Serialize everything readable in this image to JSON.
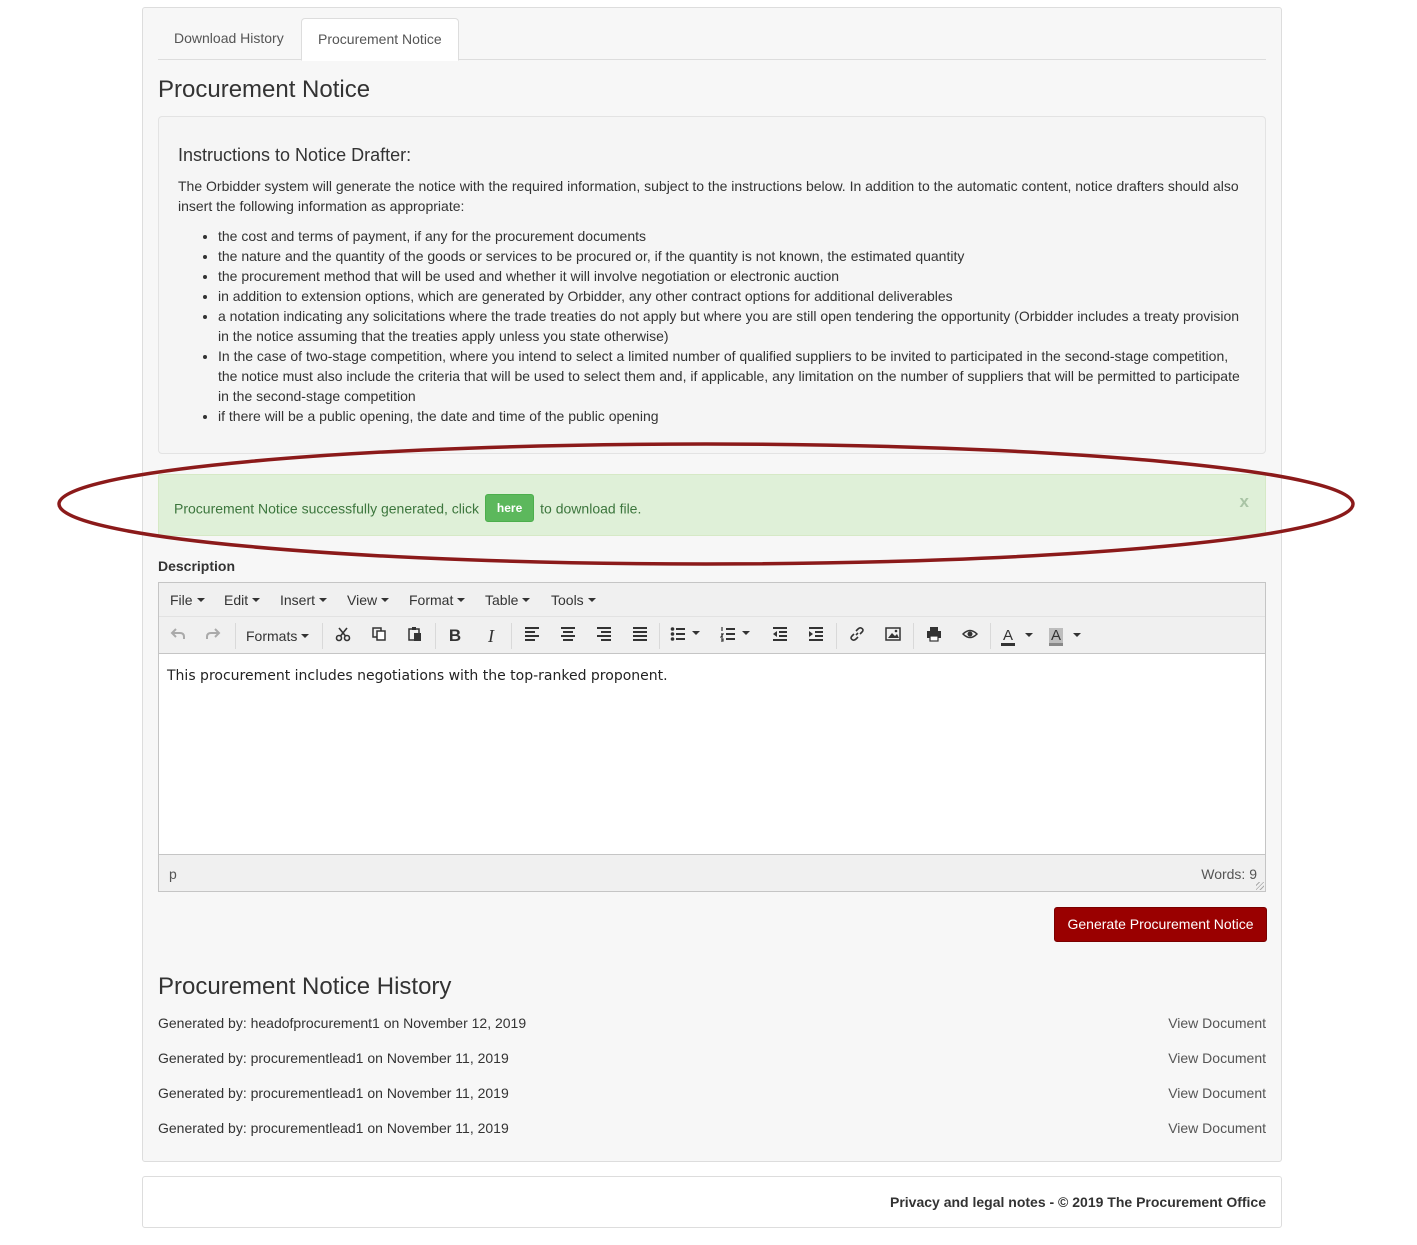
{
  "tabs": [
    {
      "label": "Download History"
    },
    {
      "label": "Procurement Notice"
    }
  ],
  "page_title": "Procurement Notice",
  "instructions": {
    "heading": "Instructions to Notice Drafter:",
    "intro": "The Orbidder system will generate the notice with the required information, subject to the instructions below. In addition to the automatic content, notice drafters should also insert the following information as appropriate:",
    "items": [
      "the cost and terms of payment, if any for the procurement documents",
      "the nature and the quantity of the goods or services to be procured or, if the quantity is not known, the estimated quantity",
      "the procurement method that will be used and whether it will involve negotiation or electronic auction",
      "in addition to extension options, which are generated by Orbidder, any other contract options for additional deliverables",
      "a notation indicating any solicitations where the trade treaties do not apply but where you are still open tendering the opportunity (Orbidder includes a treaty provision in the notice assuming that the treaties apply unless you state otherwise)",
      "In the case of two-stage competition, where you intend to select a limited number of qualified suppliers to be invited to participated in the second-stage competition, the notice must also include the criteria that will be used to select them and, if applicable, any limitation on the number of suppliers that will be permitted to participate in the second-stage competition",
      "if there will be a public opening, the date and time of the public opening"
    ]
  },
  "alert": {
    "text_before": "Procurement Notice successfully generated, click",
    "button_label": "here",
    "text_after": "to download file.",
    "close_label": "x"
  },
  "description_label": "Description",
  "editor": {
    "menu": [
      "File",
      "Edit",
      "Insert",
      "View",
      "Format",
      "Table",
      "Tools"
    ],
    "formats_label": "Formats",
    "toolbar_icons": [
      "undo-icon",
      "redo-icon",
      "cut-icon",
      "copy-icon",
      "paste-icon",
      "bold-icon",
      "italic-icon",
      "align-left-icon",
      "align-center-icon",
      "align-right-icon",
      "justify-icon",
      "bullet-list-icon",
      "numbered-list-icon",
      "outdent-icon",
      "indent-icon",
      "link-icon",
      "image-icon",
      "print-icon",
      "preview-icon",
      "text-color-icon",
      "background-color-icon"
    ],
    "content": "This procurement includes negotiations with the top-ranked proponent.",
    "status_path": "p",
    "word_count": "Words: 9"
  },
  "generate_button": "Generate Procurement Notice",
  "history": {
    "title": "Procurement Notice History",
    "link_label": "View Document",
    "rows": [
      {
        "text": "Generated by: headofprocurement1 on November 12, 2019"
      },
      {
        "text": "Generated by: procurementlead1 on November 11, 2019"
      },
      {
        "text": "Generated by: procurementlead1 on November 11, 2019"
      },
      {
        "text": "Generated by: procurementlead1 on November 11, 2019"
      }
    ]
  },
  "footer": "Privacy and legal notes - © 2019 The Procurement Office",
  "colors": {
    "accent": "#9a0000",
    "success_bg": "#dff0d8",
    "success_text": "#3c763d",
    "success_button": "#5cb85c",
    "annotation_ring": "#8b1a1a"
  }
}
